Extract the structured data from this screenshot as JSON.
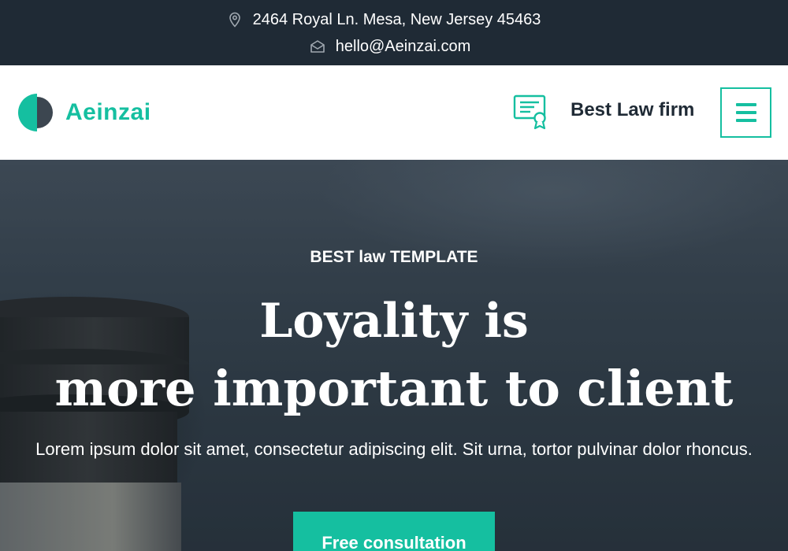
{
  "topbar": {
    "address": "2464 Royal Ln. Mesa, New Jersey 45463",
    "email": "hello@Aeinzai.com",
    "address_icon": "location-pin-icon",
    "email_icon": "envelope-icon"
  },
  "header": {
    "logo_text": "Aeinzai",
    "award_icon": "certificate-icon",
    "award_text": "Best Law firm",
    "menu_icon": "hamburger-menu-icon"
  },
  "hero": {
    "eyebrow": "BEST law TEMPLATE",
    "title_line1": "Loyality is",
    "title_line2": "more important to client",
    "description": "Lorem ipsum dolor sit amet, consectetur adipiscing elit. Sit urna, tortor pulvinar dolor rhoncus.",
    "cta_label": "Free consultation"
  },
  "colors": {
    "accent": "#15bfa0",
    "dark": "#1f2a35",
    "white": "#ffffff"
  }
}
